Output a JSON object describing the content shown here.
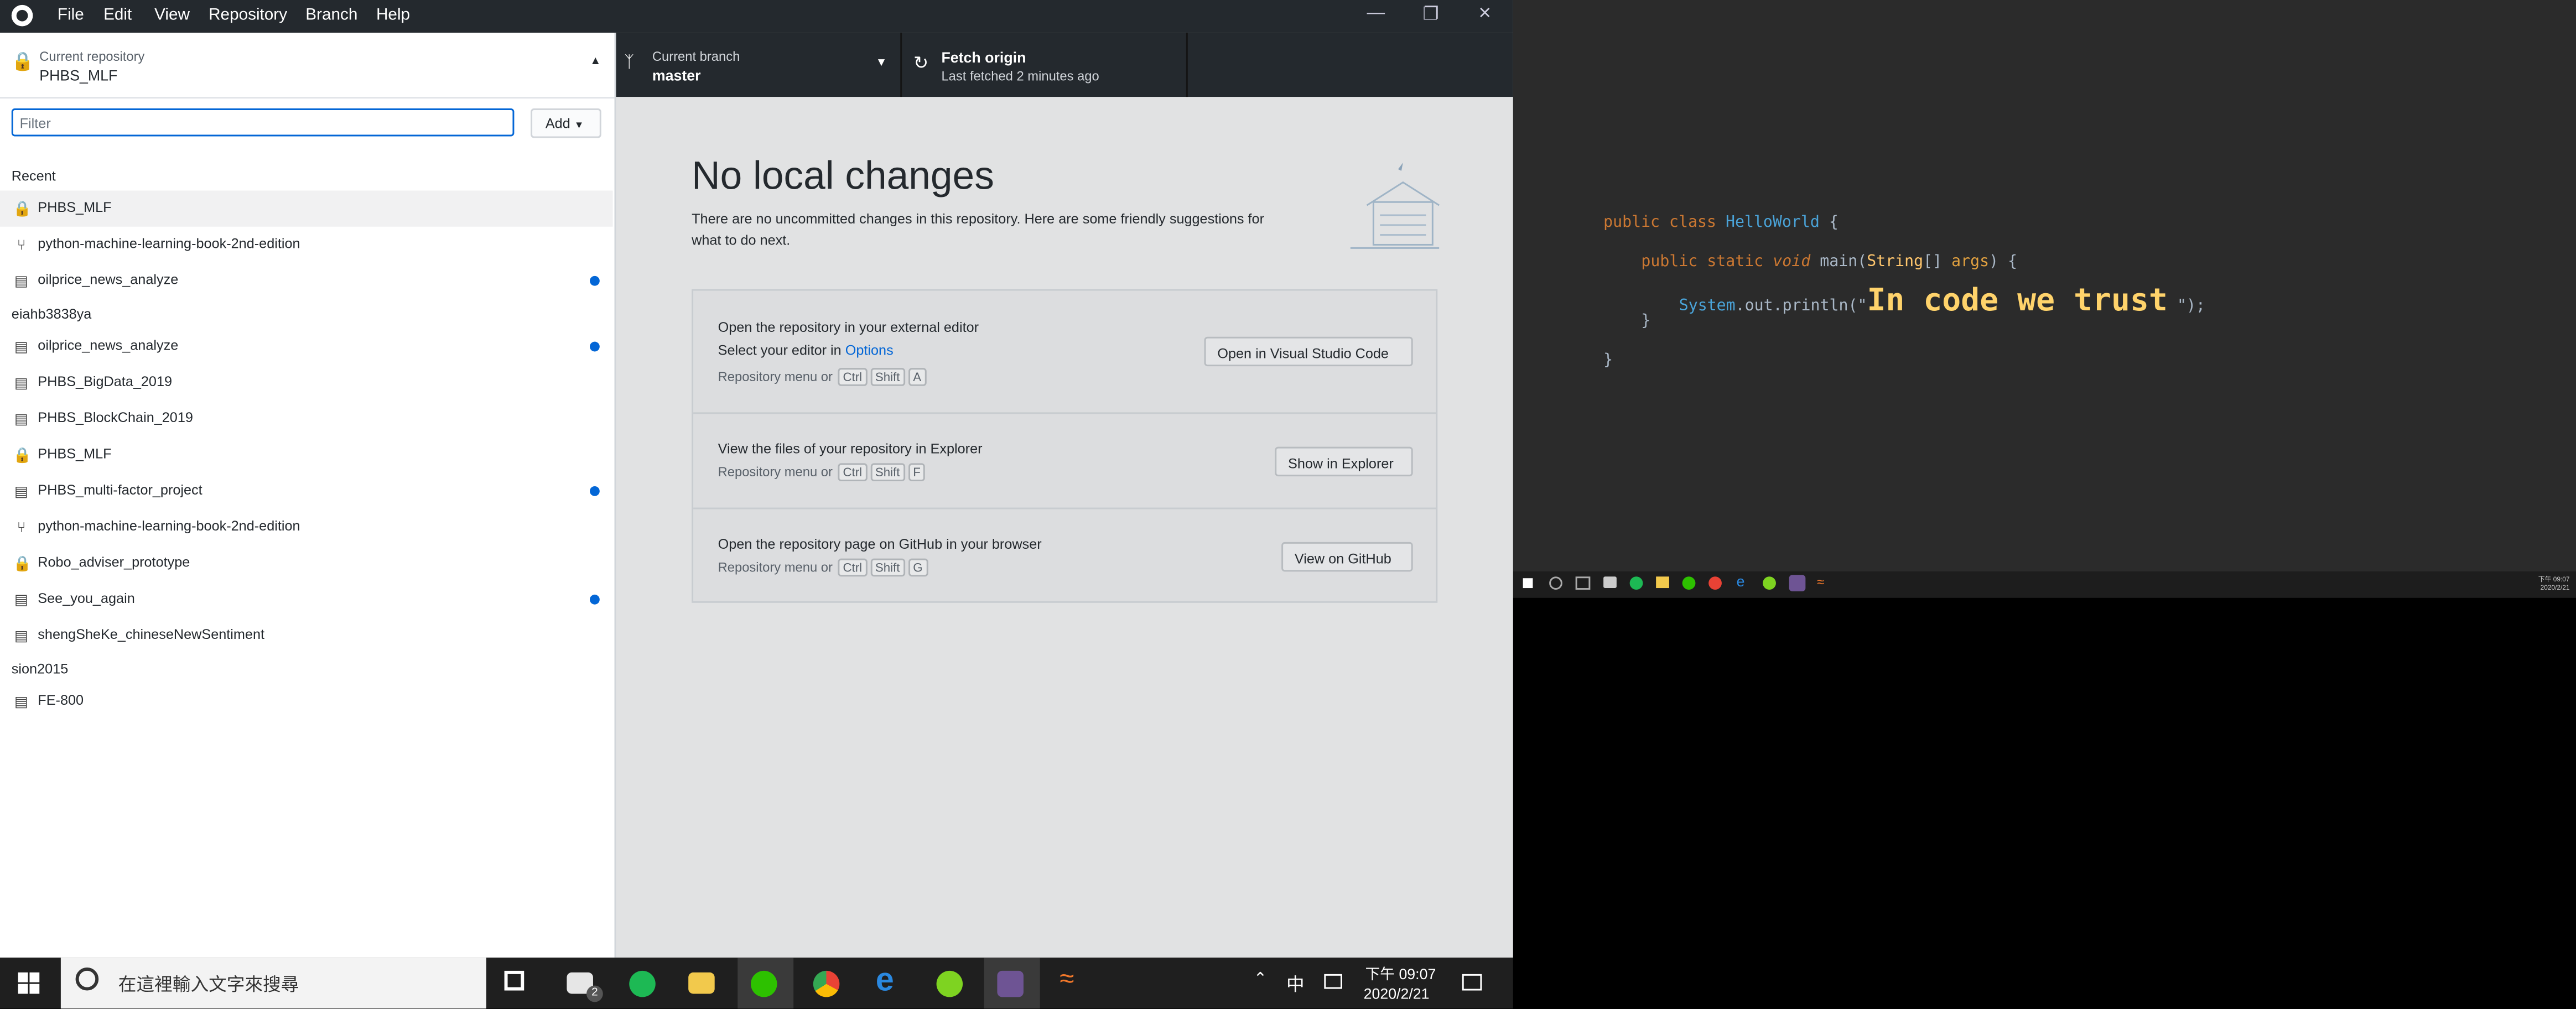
{
  "app": {
    "menu": [
      "File",
      "Edit",
      "View",
      "Repository",
      "Branch",
      "Help"
    ]
  },
  "repo": {
    "caption": "Current repository",
    "name": "PHBS_MLF"
  },
  "filter": {
    "placeholder": "Filter"
  },
  "add_label": "Add",
  "groups": [
    {
      "title": "Recent",
      "items": [
        {
          "name": "PHBS_MLF",
          "icon": "lock-icon",
          "dot": false,
          "selected": true
        },
        {
          "name": "python-machine-learning-book-2nd-edition",
          "icon": "fork-icon",
          "dot": false
        },
        {
          "name": "oilprice_news_analyze",
          "icon": "repo-icon",
          "dot": true
        }
      ]
    },
    {
      "title": "eiahb3838ya",
      "items": [
        {
          "name": "oilprice_news_analyze",
          "icon": "repo-icon",
          "dot": true
        },
        {
          "name": "PHBS_BigData_2019",
          "icon": "repo-icon",
          "dot": false
        },
        {
          "name": "PHBS_BlockChain_2019",
          "icon": "repo-icon",
          "dot": false
        },
        {
          "name": "PHBS_MLF",
          "icon": "lock-icon",
          "dot": false
        },
        {
          "name": "PHBS_multi-factor_project",
          "icon": "repo-icon",
          "dot": true
        },
        {
          "name": "python-machine-learning-book-2nd-edition",
          "icon": "fork-icon",
          "dot": false
        },
        {
          "name": "Robo_adviser_prototype",
          "icon": "lock-icon",
          "dot": false
        },
        {
          "name": "See_you_again",
          "icon": "repo-icon",
          "dot": true
        },
        {
          "name": "shengSheKe_chineseNewSentiment",
          "icon": "repo-icon",
          "dot": false
        }
      ]
    },
    {
      "title": "sion2015",
      "items": [
        {
          "name": "FE-800",
          "icon": "repo-icon",
          "dot": false
        }
      ]
    }
  ],
  "branch": {
    "caption": "Current branch",
    "name": "master"
  },
  "fetch": {
    "title": "Fetch origin",
    "sub": "Last fetched 2 minutes ago"
  },
  "main": {
    "title": "No local changes",
    "desc1": "There are no uncommitted changes in this repository. Here are some friendly suggestions for",
    "desc2": "what to do next.",
    "s1": {
      "title": "Open the repository in your external editor",
      "sub_pre": "Select your editor in ",
      "sub_link": "Options",
      "hint": "Repository menu or",
      "keys": [
        "Ctrl",
        "Shift",
        "A"
      ],
      "button": "Open in Visual Studio Code"
    },
    "s2": {
      "title": "View the files of your repository in Explorer",
      "hint": "Repository menu or",
      "keys": [
        "Ctrl",
        "Shift",
        "F"
      ],
      "button": "Show in Explorer"
    },
    "s3": {
      "title": "Open the repository page on GitHub in your browser",
      "hint": "Repository menu or",
      "keys": [
        "Ctrl",
        "Shift",
        "G"
      ],
      "button": "View on GitHub"
    }
  },
  "code": {
    "l1a": "public class",
    "l1b": "HelloWorld",
    "l1c": "{",
    "l2a": "public static",
    "l2b": "void",
    "l2c": "main(",
    "l2d": "String",
    "l2e": "[]",
    "l2f": "args",
    ") {": ") {",
    "l3a": "System",
    "l3b": ".out.println(\"",
    "l3c": "In code we trust",
    "l3d": "\");",
    "l4": "}",
    "l5": "}"
  },
  "taskbar": {
    "search": "在這裡輸入文字來搜尋",
    "time": "下午 09:07",
    "date": "2020/2/21",
    "ime": "中",
    "mail_badge": "2"
  },
  "mini_clock": {
    "time": "下午 09:07",
    "date": "2020/2/21"
  }
}
